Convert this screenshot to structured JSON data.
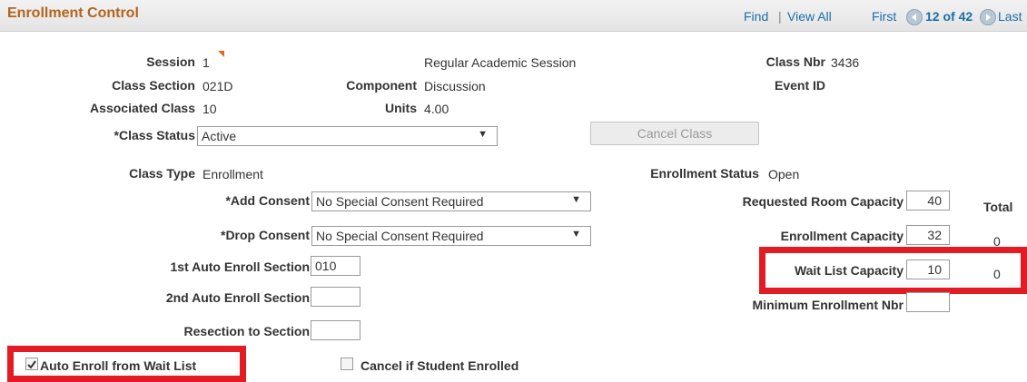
{
  "header": {
    "title": "Enrollment Control",
    "find": "Find",
    "separator": "|",
    "view_all": "View All",
    "first": "First",
    "counter": "12 of 42",
    "last": "Last"
  },
  "session": {
    "label": "Session",
    "value": "1",
    "description": "Regular Academic Session"
  },
  "class_nbr": {
    "label": "Class Nbr",
    "value": "3436"
  },
  "class_section": {
    "label": "Class Section",
    "value": "021D"
  },
  "component": {
    "label": "Component",
    "value": "Discussion"
  },
  "event_id": {
    "label": "Event ID",
    "value": ""
  },
  "associated_class": {
    "label": "Associated Class",
    "value": "10"
  },
  "units": {
    "label": "Units",
    "value": "4.00"
  },
  "class_status": {
    "label": "*Class Status",
    "value": "Active"
  },
  "cancel_class": {
    "label": "Cancel Class"
  },
  "class_type": {
    "label": "Class Type",
    "value": "Enrollment"
  },
  "enrollment_status": {
    "label": "Enrollment Status",
    "value": "Open"
  },
  "add_consent": {
    "label": "*Add Consent",
    "value": "No Special Consent Required"
  },
  "drop_consent": {
    "label": "*Drop Consent",
    "value": "No Special Consent Required"
  },
  "requested_room_capacity": {
    "label": "Requested Room Capacity",
    "value": "40"
  },
  "total": {
    "label": "Total"
  },
  "enrollment_capacity": {
    "label": "Enrollment Capacity",
    "value": "32",
    "total": "0"
  },
  "first_auto_enroll": {
    "label": "1st Auto Enroll Section",
    "value": "010"
  },
  "wait_list_capacity": {
    "label": "Wait List Capacity",
    "value": "10",
    "total": "0"
  },
  "second_auto_enroll": {
    "label": "2nd Auto Enroll Section",
    "value": ""
  },
  "minimum_enrollment": {
    "label": "Minimum Enrollment Nbr",
    "value": ""
  },
  "resection": {
    "label": "Resection to Section",
    "value": ""
  },
  "auto_enroll_wait_list": {
    "label": "Auto Enroll from Wait List",
    "checked": true
  },
  "cancel_if_enrolled": {
    "label": "Cancel if Student Enrolled",
    "checked": false
  },
  "colors": {
    "title": "#b5641b",
    "link": "#1a6fa8",
    "highlight": "#e31c23"
  }
}
